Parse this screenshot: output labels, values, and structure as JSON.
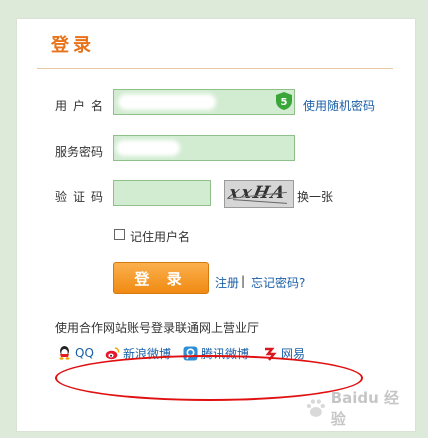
{
  "title": "登录",
  "fields": {
    "username_label": "用户名",
    "password_label": "服务密码",
    "captcha_label": "验证码"
  },
  "links": {
    "random_password": "使用随机密码",
    "refresh_captcha": "换一张",
    "register": "注册",
    "separator": "|",
    "forgot": "忘记密码?"
  },
  "captcha": {
    "image_text": "xxHA"
  },
  "remember": {
    "label": "记住用户名"
  },
  "login_button": "登 录",
  "partner": {
    "heading": "使用合作网站账号登录联通网上营业厅",
    "items": [
      {
        "label": "QQ",
        "icon": "qq-icon"
      },
      {
        "label": "新浪微博",
        "icon": "sina-weibo-icon"
      },
      {
        "label": "腾讯微博",
        "icon": "tencent-weibo-icon"
      },
      {
        "label": "网易",
        "icon": "netease-icon"
      }
    ]
  },
  "watermark": {
    "text": "Baidu 经验"
  },
  "colors": {
    "background": "#dde9d9",
    "accent": "#e8731a",
    "input_fill": "#d2ecd2",
    "link": "#1a5fa8",
    "annotation": "#e01010"
  }
}
